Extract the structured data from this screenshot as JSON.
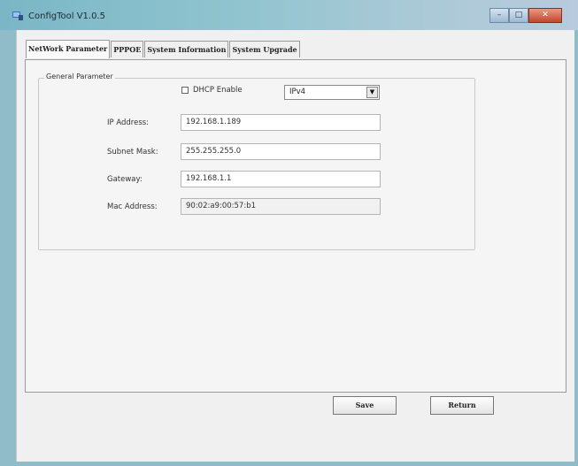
{
  "window": {
    "title": "ConfigTool V1.0.5",
    "controls": {
      "minimize": "–",
      "maximize": "□",
      "close": "✕"
    }
  },
  "tabs": [
    {
      "label": "NetWork Parameter"
    },
    {
      "label": "PPPOE"
    },
    {
      "label": "System Information"
    },
    {
      "label": "System Upgrade"
    }
  ],
  "general": {
    "group_title": "General Parameter",
    "dhcp_label": "DHCP Enable",
    "dhcp_checked": false,
    "ip_version": "IPv4",
    "ip_label": "IP Address:",
    "ip_value": "192.168.1.189",
    "mask_label": "Subnet Mask:",
    "mask_value": "255.255.255.0",
    "gateway_label": "Gateway:",
    "gateway_value": "192.168.1.1",
    "mac_label": "Mac Address:",
    "mac_value": "90:02:a9:00:57:b1"
  },
  "buttons": {
    "save": "Save",
    "return": "Return"
  }
}
